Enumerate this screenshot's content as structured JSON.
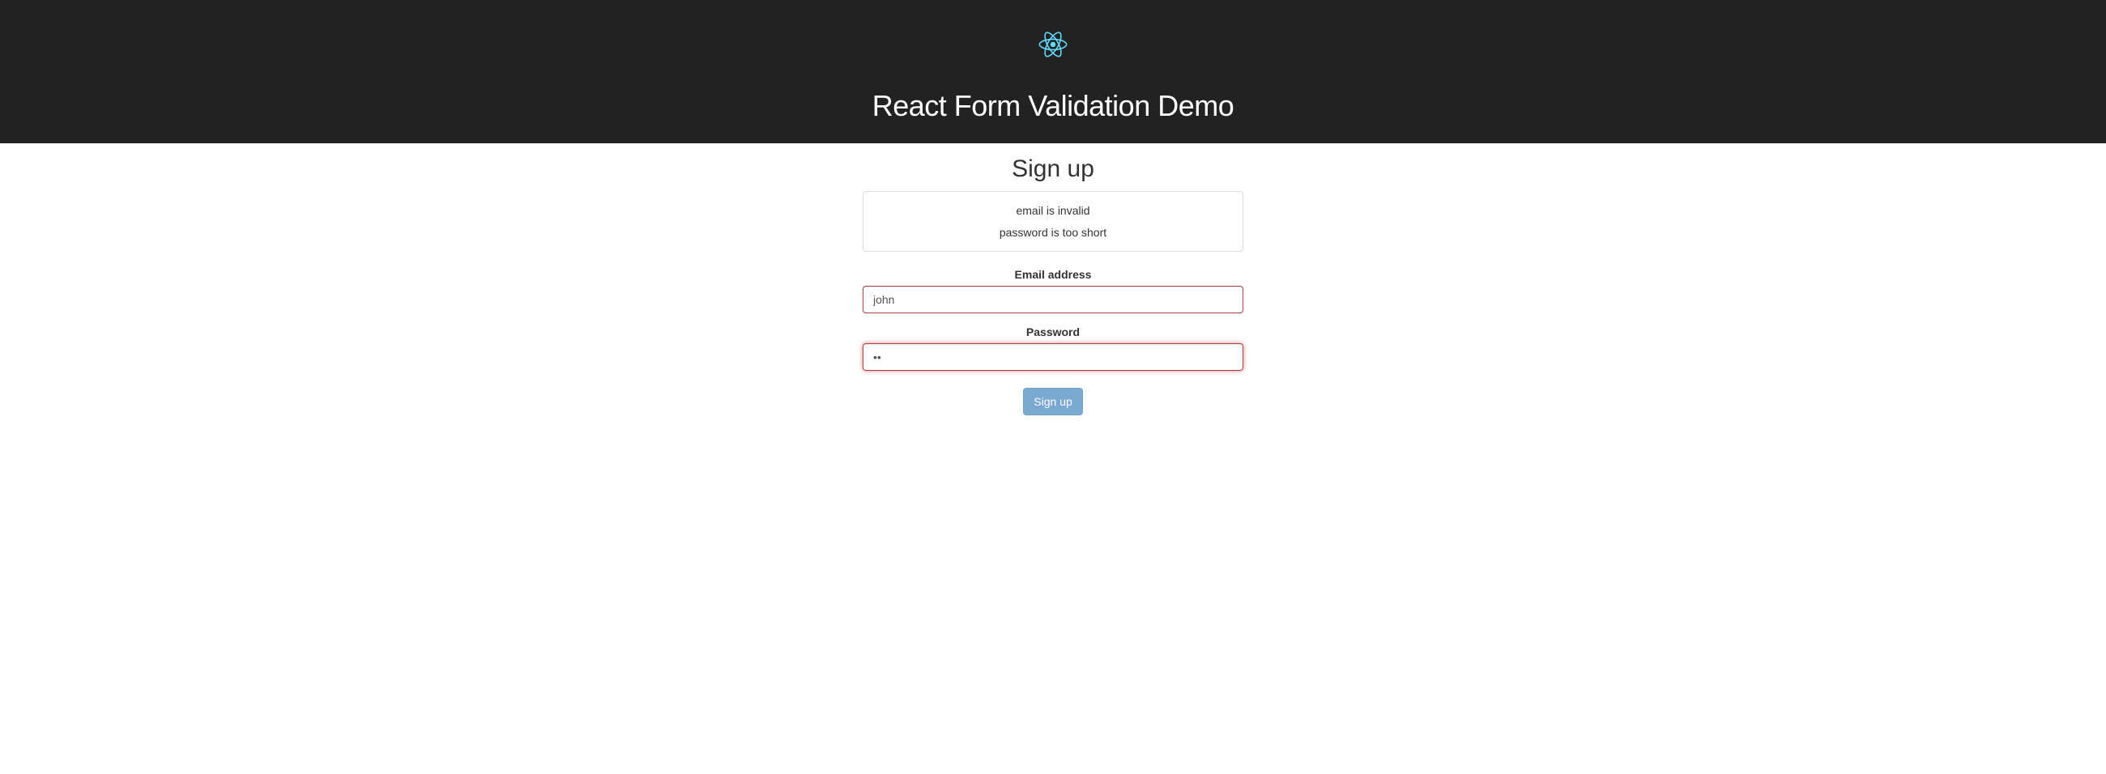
{
  "header": {
    "title": "React Form Validation Demo"
  },
  "form": {
    "title": "Sign up",
    "errors": [
      "email is invalid",
      "password is too short"
    ],
    "fields": {
      "email": {
        "label": "Email address",
        "value": "john"
      },
      "password": {
        "label": "Password",
        "value": "••"
      }
    },
    "submit_label": "Sign up"
  }
}
